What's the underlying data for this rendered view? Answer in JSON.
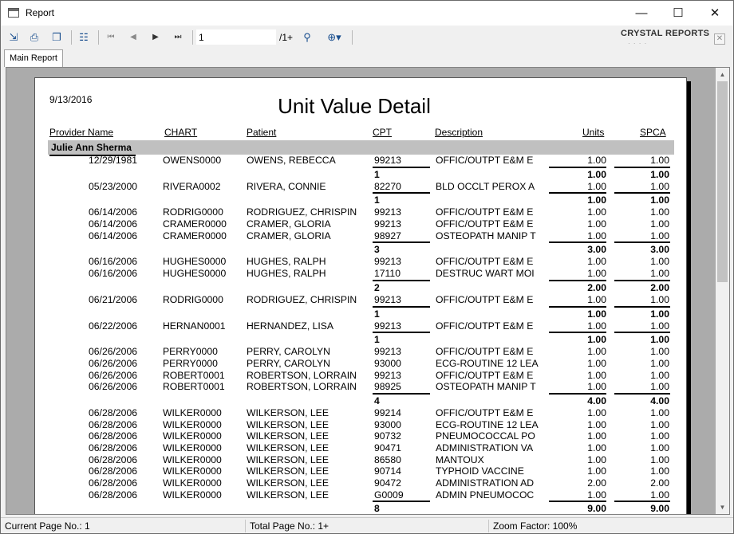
{
  "window": {
    "title": "Report",
    "minimize": "—",
    "maximize": "☐",
    "close": "✕"
  },
  "toolbar": {
    "current_page": "1",
    "total_pages": "/1+",
    "brand": "CRYSTAL REPORTS",
    "brand_sub": "· · · ·",
    "close_glyph": "✕",
    "icons": [
      "export-icon",
      "print-icon",
      "copy-icon",
      "group-tree-icon",
      "first-page-icon",
      "previous-page-icon",
      "next-page-icon",
      "last-page-icon",
      "find-icon",
      "zoom-icon"
    ]
  },
  "tabs": [
    {
      "label": "Main Report"
    }
  ],
  "report": {
    "date": "9/13/2016",
    "title": "Unit Value Detail",
    "headers": {
      "provider": "Provider Name",
      "chart": "CHART",
      "patient": "Patient",
      "cpt": "CPT",
      "description": "Description",
      "units": "Units",
      "spca": "SPCA"
    },
    "group_name": "Julie Ann Sherma",
    "blocks": [
      {
        "rows": [
          {
            "date": "12/29/1981",
            "chart": "OWENS0000",
            "patient": "OWENS, REBECCA",
            "cpt": "99213",
            "desc": "OFFIC/OUTPT E&M E",
            "units": "1.00",
            "spca": "1.00"
          }
        ],
        "subtotal": {
          "count": "1",
          "units": "1.00",
          "spca": "1.00"
        }
      },
      {
        "rows": [
          {
            "date": "05/23/2000",
            "chart": "RIVERA0002",
            "patient": "RIVERA, CONNIE",
            "cpt": "82270",
            "desc": "BLD OCCLT PEROX A",
            "units": "1.00",
            "spca": "1.00"
          }
        ],
        "subtotal": {
          "count": "1",
          "units": "1.00",
          "spca": "1.00"
        }
      },
      {
        "rows": [
          {
            "date": "06/14/2006",
            "chart": "RODRIG0000",
            "patient": "RODRIGUEZ, CHRISPIN",
            "cpt": "99213",
            "desc": "OFFIC/OUTPT E&M E",
            "units": "1.00",
            "spca": "1.00"
          },
          {
            "date": "06/14/2006",
            "chart": "CRAMER0000",
            "patient": "CRAMER, GLORIA",
            "cpt": "99213",
            "desc": "OFFIC/OUTPT E&M E",
            "units": "1.00",
            "spca": "1.00"
          },
          {
            "date": "06/14/2006",
            "chart": "CRAMER0000",
            "patient": "CRAMER, GLORIA",
            "cpt": "98927",
            "desc": "OSTEOPATH MANIP T",
            "units": "1.00",
            "spca": "1.00"
          }
        ],
        "subtotal": {
          "count": "3",
          "units": "3.00",
          "spca": "3.00"
        }
      },
      {
        "rows": [
          {
            "date": "06/16/2006",
            "chart": "HUGHES0000",
            "patient": "HUGHES, RALPH",
            "cpt": "99213",
            "desc": "OFFIC/OUTPT E&M E",
            "units": "1.00",
            "spca": "1.00"
          },
          {
            "date": "06/16/2006",
            "chart": "HUGHES0000",
            "patient": "HUGHES, RALPH",
            "cpt": "17110",
            "desc": "DESTRUC WART MOI",
            "units": "1.00",
            "spca": "1.00"
          }
        ],
        "subtotal": {
          "count": "2",
          "units": "2.00",
          "spca": "2.00"
        }
      },
      {
        "rows": [
          {
            "date": "06/21/2006",
            "chart": "RODRIG0000",
            "patient": "RODRIGUEZ, CHRISPIN",
            "cpt": "99213",
            "desc": "OFFIC/OUTPT E&M E",
            "units": "1.00",
            "spca": "1.00"
          }
        ],
        "subtotal": {
          "count": "1",
          "units": "1.00",
          "spca": "1.00"
        }
      },
      {
        "rows": [
          {
            "date": "06/22/2006",
            "chart": "HERNAN0001",
            "patient": "HERNANDEZ, LISA",
            "cpt": "99213",
            "desc": "OFFIC/OUTPT E&M E",
            "units": "1.00",
            "spca": "1.00"
          }
        ],
        "subtotal": {
          "count": "1",
          "units": "1.00",
          "spca": "1.00"
        }
      },
      {
        "rows": [
          {
            "date": "06/26/2006",
            "chart": "PERRY0000",
            "patient": "PERRY, CAROLYN",
            "cpt": "99213",
            "desc": "OFFIC/OUTPT E&M E",
            "units": "1.00",
            "spca": "1.00"
          },
          {
            "date": "06/26/2006",
            "chart": "PERRY0000",
            "patient": "PERRY, CAROLYN",
            "cpt": "93000",
            "desc": "ECG-ROUTINE 12 LEA",
            "units": "1.00",
            "spca": "1.00"
          },
          {
            "date": "06/26/2006",
            "chart": "ROBERT0001",
            "patient": "ROBERTSON, LORRAIN",
            "cpt": "99213",
            "desc": "OFFIC/OUTPT E&M E",
            "units": "1.00",
            "spca": "1.00"
          },
          {
            "date": "06/26/2006",
            "chart": "ROBERT0001",
            "patient": "ROBERTSON, LORRAIN",
            "cpt": "98925",
            "desc": "OSTEOPATH MANIP T",
            "units": "1.00",
            "spca": "1.00"
          }
        ],
        "subtotal": {
          "count": "4",
          "units": "4.00",
          "spca": "4.00"
        }
      },
      {
        "rows": [
          {
            "date": "06/28/2006",
            "chart": "WILKER0000",
            "patient": "WILKERSON, LEE",
            "cpt": "99214",
            "desc": "OFFIC/OUTPT E&M E",
            "units": "1.00",
            "spca": "1.00"
          },
          {
            "date": "06/28/2006",
            "chart": "WILKER0000",
            "patient": "WILKERSON, LEE",
            "cpt": "93000",
            "desc": "ECG-ROUTINE 12 LEA",
            "units": "1.00",
            "spca": "1.00"
          },
          {
            "date": "06/28/2006",
            "chart": "WILKER0000",
            "patient": "WILKERSON, LEE",
            "cpt": "90732",
            "desc": "PNEUMOCOCCAL PO",
            "units": "1.00",
            "spca": "1.00"
          },
          {
            "date": "06/28/2006",
            "chart": "WILKER0000",
            "patient": "WILKERSON, LEE",
            "cpt": "90471",
            "desc": "ADMINISTRATION VA",
            "units": "1.00",
            "spca": "1.00"
          },
          {
            "date": "06/28/2006",
            "chart": "WILKER0000",
            "patient": "WILKERSON, LEE",
            "cpt": "86580",
            "desc": "MANTOUX",
            "units": "1.00",
            "spca": "1.00"
          },
          {
            "date": "06/28/2006",
            "chart": "WILKER0000",
            "patient": "WILKERSON, LEE",
            "cpt": "90714",
            "desc": "TYPHOID VACCINE",
            "units": "1.00",
            "spca": "1.00"
          },
          {
            "date": "06/28/2006",
            "chart": "WILKER0000",
            "patient": "WILKERSON, LEE",
            "cpt": "90472",
            "desc": "ADMINISTRATION AD",
            "units": "2.00",
            "spca": "2.00"
          },
          {
            "date": "06/28/2006",
            "chart": "WILKER0000",
            "patient": "WILKERSON, LEE",
            "cpt": "G0009",
            "desc": "ADMIN PNEUMOCOC",
            "units": "1.00",
            "spca": "1.00"
          }
        ],
        "subtotal": {
          "count": "8",
          "units": "9.00",
          "spca": "9.00"
        }
      }
    ]
  },
  "status": {
    "current_page": "Current Page No.: 1",
    "total_page": "Total Page No.: 1+",
    "zoom": "Zoom Factor: 100%"
  }
}
